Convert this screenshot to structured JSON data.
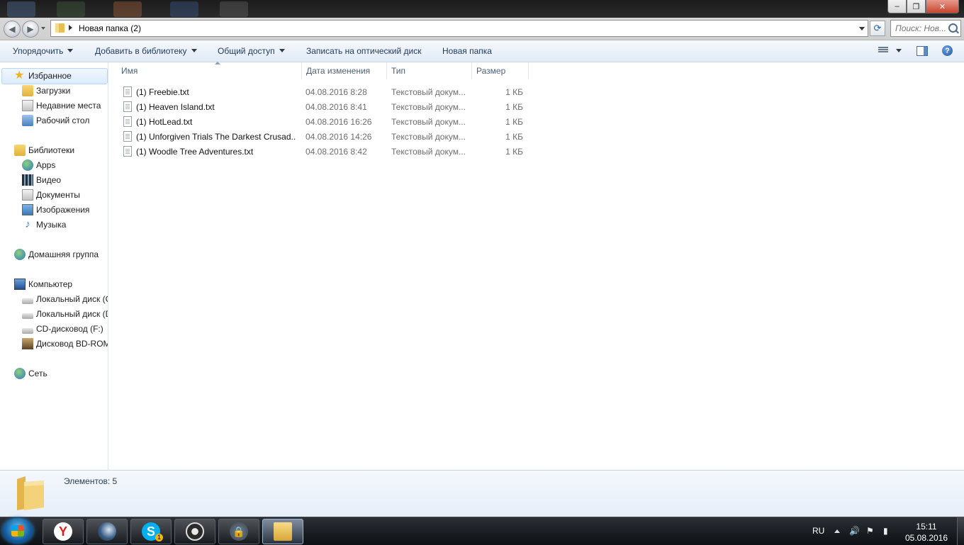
{
  "window": {
    "minimize_glyph": "–",
    "maximize_glyph": "❐",
    "close_glyph": "✕"
  },
  "address": {
    "path": "Новая папка (2)",
    "search_placeholder": "Поиск: Нов..."
  },
  "toolbar": {
    "organize": "Упорядочить",
    "add_to_library": "Добавить в библиотеку",
    "share": "Общий доступ",
    "burn": "Записать на оптический диск",
    "new_folder": "Новая папка"
  },
  "nav": {
    "favorites": "Избранное",
    "downloads": "Загрузки",
    "recent": "Недавние места",
    "desktop": "Рабочий стол",
    "libraries": "Библиотеки",
    "apps": "Apps",
    "video": "Видео",
    "documents": "Документы",
    "images": "Изображения",
    "music": "Музыка",
    "homegroup": "Домашняя группа",
    "computer": "Компьютер",
    "local_c": "Локальный диск (C",
    "local_d": "Локальный диск (D",
    "cd": "CD-дисковод (F:)",
    "bd": "Дисковод BD-ROM",
    "network": "Сеть"
  },
  "columns": {
    "name": "Имя",
    "date": "Дата изменения",
    "type": "Тип",
    "size": "Размер"
  },
  "files": [
    {
      "name": "(1) Freebie.txt",
      "date": "04.08.2016 8:28",
      "type": "Текстовый докум...",
      "size": "1 КБ"
    },
    {
      "name": "(1) Heaven Island.txt",
      "date": "04.08.2016 8:41",
      "type": "Текстовый докум...",
      "size": "1 КБ"
    },
    {
      "name": "(1) HotLead.txt",
      "date": "04.08.2016 16:26",
      "type": "Текстовый докум...",
      "size": "1 КБ"
    },
    {
      "name": "(1) Unforgiven Trials The Darkest Crusad...",
      "date": "04.08.2016 14:26",
      "type": "Текстовый докум...",
      "size": "1 КБ"
    },
    {
      "name": "(1) Woodle Tree Adventures.txt",
      "date": "04.08.2016 8:42",
      "type": "Текстовый докум...",
      "size": "1 КБ"
    }
  ],
  "details": {
    "item_count": "Элементов: 5"
  },
  "taskbar": {
    "apps": [
      "yandex-browser",
      "steam",
      "skype",
      "obs",
      "lock-app",
      "windows-explorer"
    ],
    "skype_badge": "1",
    "language": "RU",
    "time": "15:11",
    "date": "05.08.2016"
  }
}
